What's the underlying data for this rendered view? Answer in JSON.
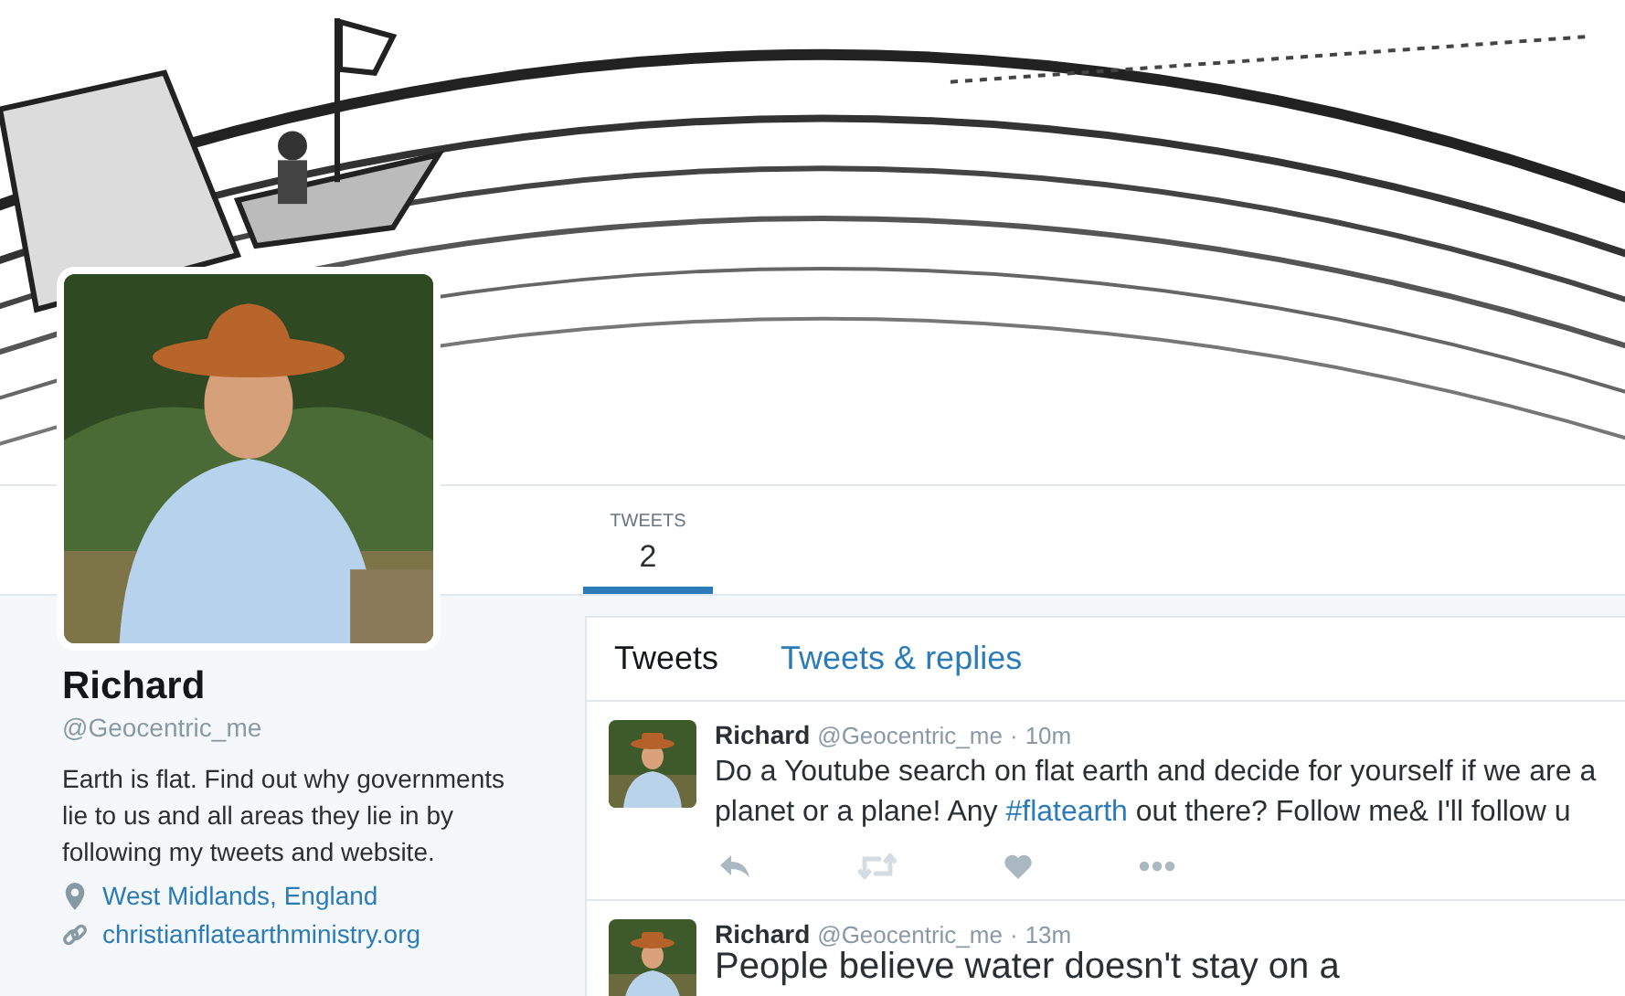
{
  "profile": {
    "name": "Richard",
    "handle": "@Geocentric_me",
    "bio": "Earth is flat. Find out why governments lie to us and all areas they lie in by following my tweets and website.",
    "location": "West Midlands, England",
    "website": "christianflatearthministry.org"
  },
  "stats": [
    {
      "label": "TWEETS",
      "count": "2",
      "selected": true
    }
  ],
  "timeline_tabs": [
    {
      "label": "Tweets",
      "selected": true
    },
    {
      "label": "Tweets & replies",
      "selected": false
    }
  ],
  "tweets": [
    {
      "name": "Richard",
      "handle": "@Geocentric_me",
      "separator": "·",
      "time": "10m",
      "kind": "normal",
      "text": [
        {
          "kind": "plain",
          "text": "Do a Youtube search on flat earth and decide for yourself if we are a planet or a plane! Any "
        },
        {
          "kind": "hashtag",
          "text": "#flatearth"
        },
        {
          "kind": "plain",
          "text": " out there? Follow me& I'll follow u"
        }
      ],
      "actions": [
        {
          "kind": "reply"
        },
        {
          "kind": "retweet"
        },
        {
          "kind": "like"
        },
        {
          "kind": "more"
        }
      ]
    },
    {
      "name": "Richard",
      "handle": "@Geocentric_me",
      "separator": "·",
      "time": "13m",
      "kind": "large",
      "text": [
        {
          "kind": "plain",
          "text": "People believe water doesn't stay on a"
        }
      ]
    }
  ]
}
